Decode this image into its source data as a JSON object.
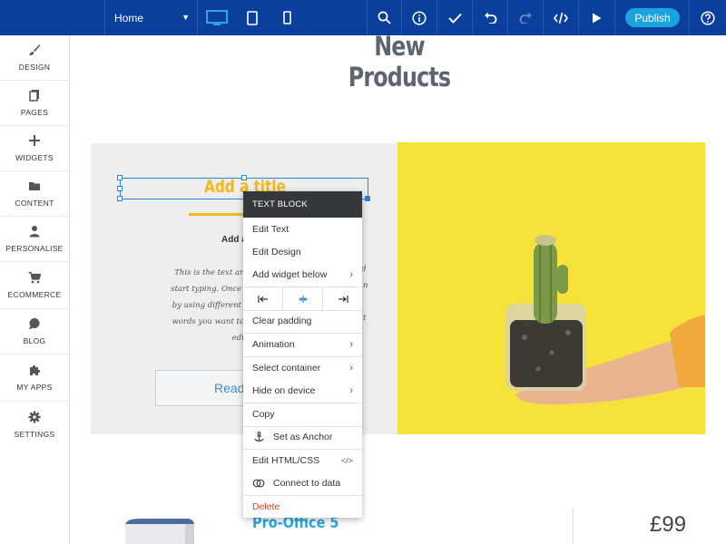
{
  "topbar": {
    "page_select": "Home",
    "publish_label": "Publish"
  },
  "sidebar": {
    "items": [
      {
        "label": "DESIGN",
        "icon": "brush-icon"
      },
      {
        "label": "PAGES",
        "icon": "pages-icon"
      },
      {
        "label": "WIDGETS",
        "icon": "plus-icon"
      },
      {
        "label": "CONTENT",
        "icon": "folder-icon"
      },
      {
        "label": "PERSONALISE",
        "icon": "person-icon"
      },
      {
        "label": "ECOMMERCE",
        "icon": "cart-icon"
      },
      {
        "label": "BLOG",
        "icon": "chat-bubble-icon"
      },
      {
        "label": "MY APPS",
        "icon": "puzzle-icon"
      },
      {
        "label": "SETTINGS",
        "icon": "gear-icon"
      }
    ]
  },
  "canvas": {
    "heading": "New Products",
    "title_text": "Add a title",
    "subtitle_fragment": "Add a s",
    "script_lines": [
      "This is the text area for this paragr",
      "start typing. Once you've added your",
      "by using different colours, fonts, fon",
      "words you want to design and choos",
      "editin"
    ],
    "script_right": [
      "d",
      "n",
      "t"
    ],
    "read_button": "Read",
    "product_name": "Pro-Office 5",
    "price": "£99"
  },
  "context_menu": {
    "header": "TEXT BLOCK",
    "edit_text": "Edit Text",
    "edit_design": "Edit Design",
    "add_widget_below": "Add widget below",
    "clear_padding": "Clear padding",
    "animation": "Animation",
    "select_container": "Select container",
    "hide_on_device": "Hide on device",
    "copy": "Copy",
    "set_as_anchor": "Set as Anchor",
    "edit_html_css": "Edit HTML/CSS",
    "connect_to_data": "Connect to data",
    "delete": "Delete"
  },
  "colors": {
    "topbar": "#0b3f9e",
    "publish": "#1ba3e0",
    "accent_yellow": "#f1b81c",
    "selection_blue": "#2a86d6",
    "delete_red": "#d2432b"
  }
}
